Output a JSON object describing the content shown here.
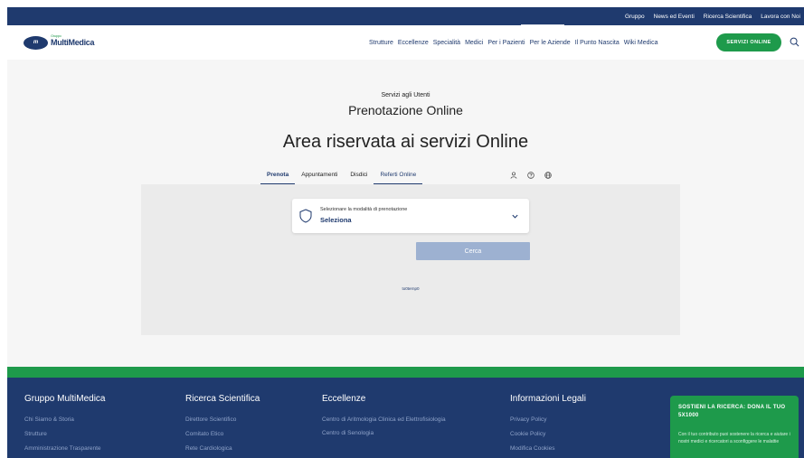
{
  "topbar": {
    "links": [
      "Gruppo",
      "News ed Eventi",
      "Ricerca Scientifica",
      "Lavora con Noi"
    ]
  },
  "header": {
    "logo_mark": "m",
    "logo_small": "Gruppo",
    "logo_text": "MultiMedica",
    "nav": [
      "Strutture",
      "Eccellenze",
      "Specialità",
      "Medici",
      "Per i Pazienti",
      "Per le Aziende",
      "Il Punto Nascita",
      "Wiki Medica"
    ],
    "cta": "SERVIZI ONLINE",
    "search_icon": "search-icon"
  },
  "main": {
    "subtitle": "Servizi agli Utenti",
    "title": "Prenotazione Online",
    "area_title": "Area riservata ai servizi Online",
    "tabs": [
      {
        "label": "Prenota"
      },
      {
        "label": "Appuntamenti"
      },
      {
        "label": "Disdici"
      },
      {
        "label": "Referti Online"
      }
    ],
    "select": {
      "label": "Selezionare la modalità di prenotazione",
      "value": "Seleziona"
    },
    "search_button": "Cerca",
    "small_link": "to0ternp0"
  },
  "footer": {
    "columns": [
      {
        "heading": "Gruppo MultiMedica",
        "items": [
          "Chi Siamo & Storia",
          "Strutture",
          "Amministrazione Trasparente"
        ]
      },
      {
        "heading": "Ricerca Scientifica",
        "items": [
          "Direttore Scientifico",
          "Comitato Etico",
          "Rete Cardiologica"
        ]
      },
      {
        "heading": "Eccellenze",
        "items": [
          "Centro di Aritmologia Clinica ed Elettrofisiologia",
          "Centro di Senologia"
        ]
      },
      {
        "heading": "Informazioni Legali",
        "items": [
          "Privacy Policy",
          "Cookie Policy",
          "Modifica Cookies"
        ]
      }
    ],
    "support": {
      "title": "SOSTIENI LA RICERCA: DONA IL TUO 5X1000",
      "text": "Con il tuo contributo puoi sostenere la ricerca e aiutare i nostri medici e ricercatori a sconfiggere le malattie"
    }
  },
  "colors": {
    "brand_navy": "#1f3a6e",
    "brand_green": "#1e9a4b",
    "button_disabled": "#9db1d1"
  }
}
